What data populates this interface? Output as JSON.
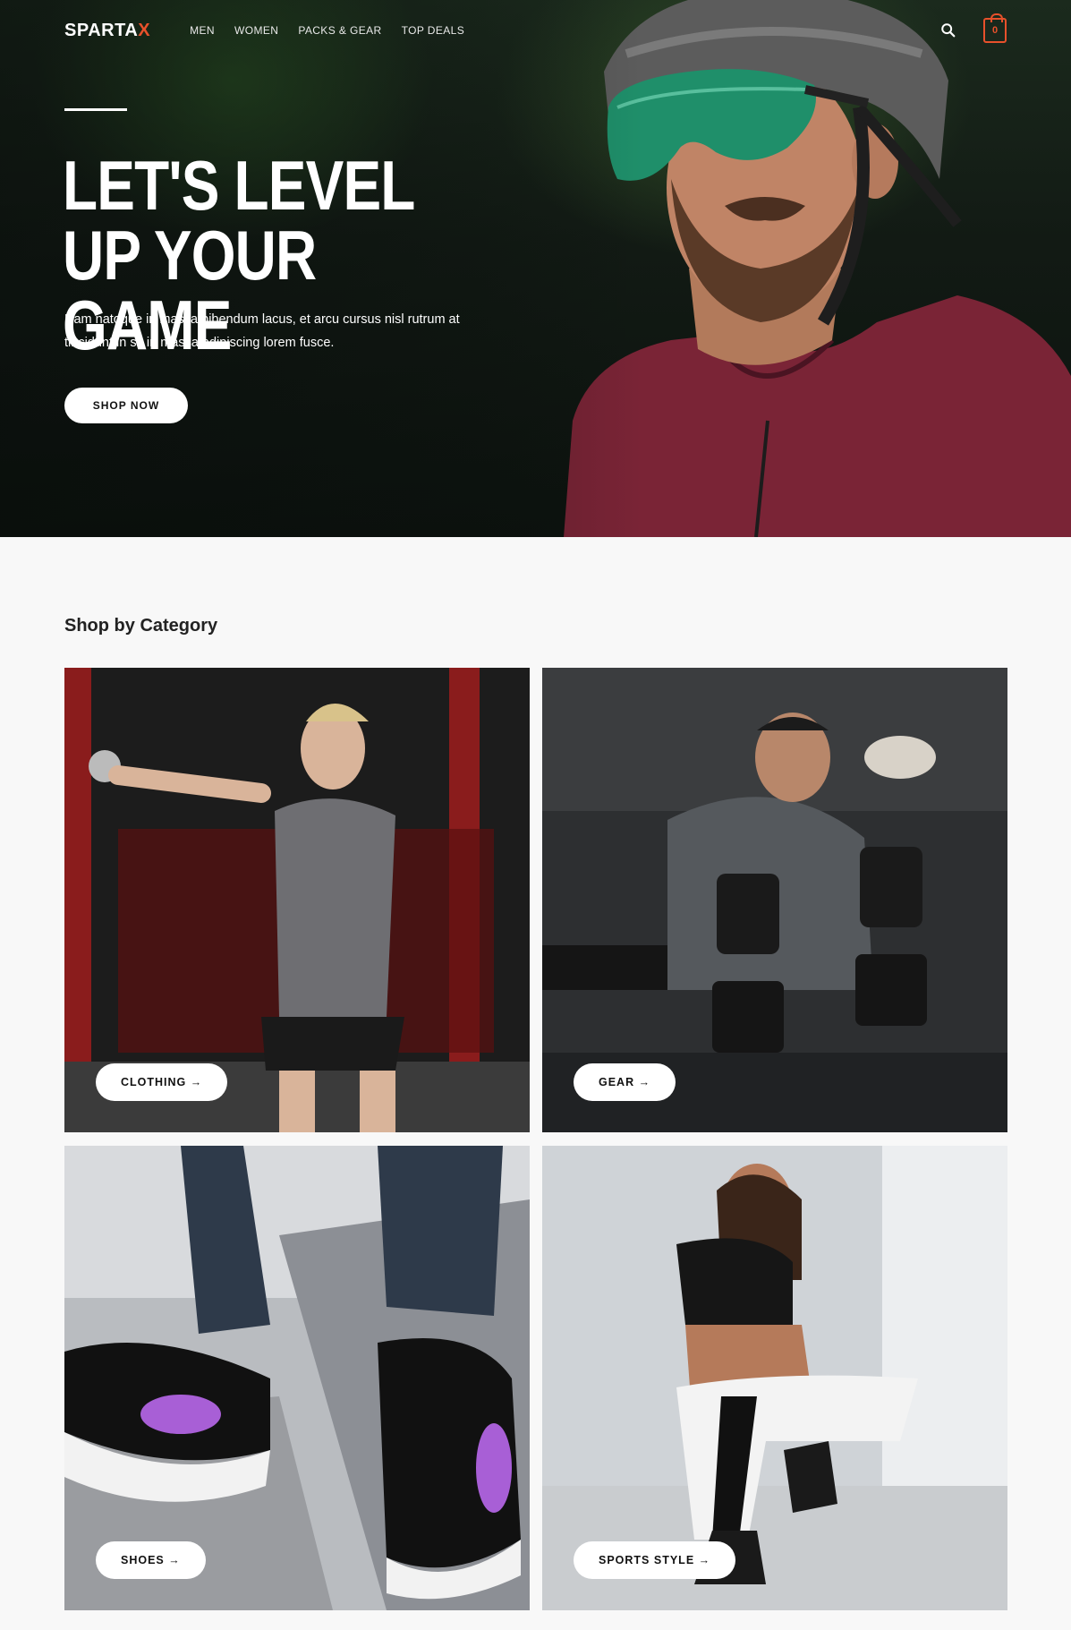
{
  "header": {
    "logo_main": "SPARTA",
    "logo_accent": "X",
    "nav": [
      "MEN",
      "WOMEN",
      "PACKS & GEAR",
      "TOP DEALS"
    ],
    "cart_count": "0"
  },
  "hero": {
    "title": "LET'S LEVEL UP YOUR GAME",
    "text": "Nam natoque in massa bibendum lacus, et arcu cursus nisl rutrum at tincidunt in sit in massa adipiscing lorem fusce.",
    "cta": "SHOP NOW"
  },
  "categories": {
    "title": "Shop by Category",
    "items": [
      {
        "label": "CLOTHING →"
      },
      {
        "label": "GEAR →"
      },
      {
        "label": "SHOES →"
      },
      {
        "label": "SPORTS STYLE →"
      }
    ]
  },
  "colors": {
    "accent": "#e8512b",
    "background": "#f8f8f8"
  }
}
